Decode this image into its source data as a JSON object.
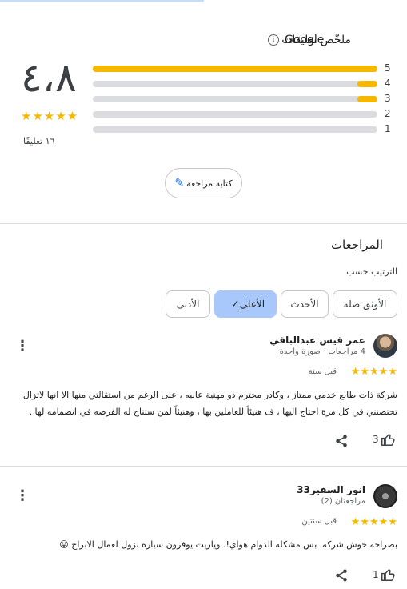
{
  "summary": {
    "title": "ملخّص تعليقات",
    "brand": "Google",
    "info_icon": "i",
    "rating": "٤،٨",
    "stars": "★★★★★",
    "count_text": "١٦ تعليقًا",
    "distribution": [
      {
        "label": "5",
        "fraction": 1.0
      },
      {
        "label": "4",
        "fraction": 0.07
      },
      {
        "label": "3",
        "fraction": 0.07
      },
      {
        "label": "2",
        "fraction": 0.0
      },
      {
        "label": "1",
        "fraction": 0.0
      }
    ],
    "write_review": "كتابة مراجعة",
    "pencil_icon": "✎"
  },
  "reviews_section": {
    "heading": "المراجعات",
    "sort_label": "الترتيب حسب",
    "chips": [
      "الأوثق صلة",
      "الأحدث",
      "الأعلى",
      "الأدنى"
    ],
    "selected_chip": "الأعلى",
    "check_icon": "✓"
  },
  "reviews": [
    {
      "name": "عمر قيس عبدالباقي",
      "meta": "4 مراجعات · صورة واحدة",
      "stars": "★★★★★",
      "time": "قبل سنة",
      "text": "شركة ذات طابع خدمي ممتاز ، وكادر محترم ذو مهنية عاليه ، على الرغم من استقالتي منها الا انها لاتزال تحتضنني في كل مرة احتاج اليها ، ف هنيئاً للعاملين بها ، وهنيئاً لمن ستتاح له الفرصه في انضمامه لها .",
      "likes": "3"
    },
    {
      "name": "انور السفير33",
      "meta": "مراجعتان (2)",
      "stars": "★★★★★",
      "time": "قبل سنتين",
      "text": "بصراحه خوش شركه. بس مشكله الدوام هواي!. وياريت يوفرون سياره نزول لعمال الابراج 😝",
      "likes": "1"
    }
  ],
  "icons": {
    "kebab": "⋮",
    "thumb": "👍"
  },
  "colors": {
    "star": "#f5b700",
    "selected_chip": "#a8c7fa",
    "track": "#dadce0"
  }
}
